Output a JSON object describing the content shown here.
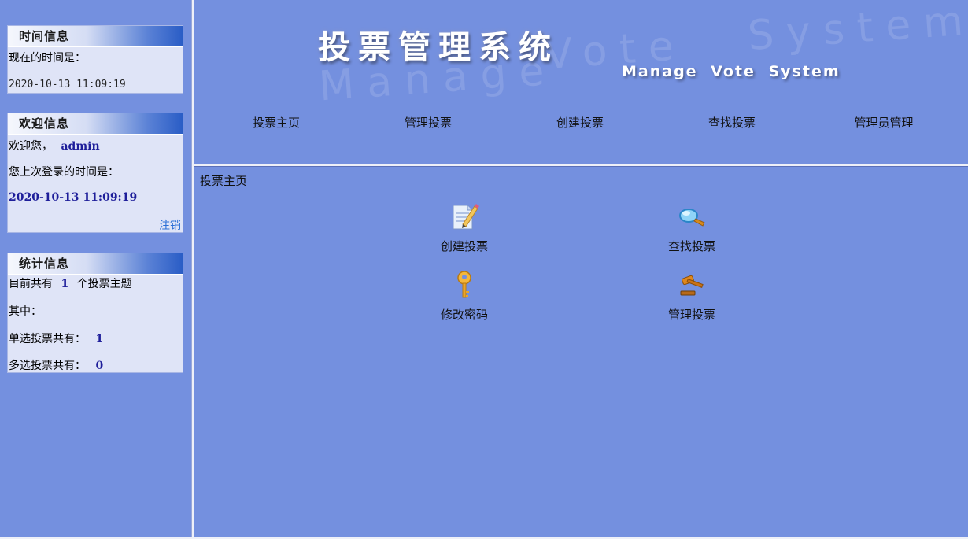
{
  "header": {
    "title": "投票管理系统",
    "subtitle": "Manage  Vote  System",
    "watermark_left": "Manage",
    "watermark_mid": "Vote",
    "watermark_right": "System"
  },
  "nav": {
    "items": [
      {
        "label": "投票主页"
      },
      {
        "label": "管理投票"
      },
      {
        "label": "创建投票"
      },
      {
        "label": "查找投票"
      },
      {
        "label": "管理员管理"
      }
    ]
  },
  "sidebar": {
    "time_panel": {
      "title": "时间信息",
      "label": "现在的时间是：",
      "value": "2020-10-13 11:09:19"
    },
    "welcome_panel": {
      "title": "欢迎信息",
      "greeting": "欢迎您，",
      "username": "admin",
      "last_login_label": "您上次登录的时间是：",
      "last_login_value": "2020-10-13 11:09:19",
      "logout": "注销"
    },
    "stats_panel": {
      "title": "统计信息",
      "total_prefix": "目前共有",
      "total_count": "1",
      "total_suffix": "个投票主题",
      "among": "其中：",
      "single_label": "单选投票共有：",
      "single_count": "1",
      "multi_label": "多选投票共有：",
      "multi_count": "0"
    }
  },
  "main": {
    "breadcrumb": "投票主页",
    "tiles": [
      {
        "label": "创建投票",
        "icon": "pencil-note-icon"
      },
      {
        "label": "查找投票",
        "icon": "magnifier-icon"
      },
      {
        "label": "修改密码",
        "icon": "key-icon"
      },
      {
        "label": "管理投票",
        "icon": "gavel-icon"
      }
    ]
  },
  "colors": {
    "background": "#7490df",
    "panel": "#dfe4f7",
    "value_text": "#1e1e9a",
    "link": "#2b6fd6"
  }
}
